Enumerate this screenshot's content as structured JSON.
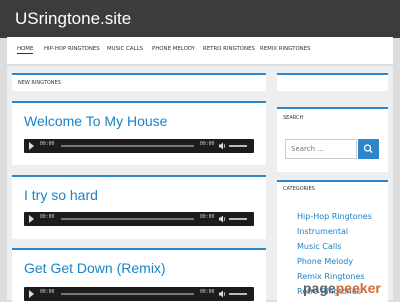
{
  "site": {
    "title": "USringtone.site"
  },
  "nav": {
    "items": [
      {
        "label": "Home"
      },
      {
        "label": "Hip-Hop Ringtones"
      },
      {
        "label": "Music Calls"
      },
      {
        "label": "Phone Melody"
      },
      {
        "label": "Retro Ringtones"
      },
      {
        "label": "Remix Ringtones"
      }
    ]
  },
  "main": {
    "section_title": "New Ringtones",
    "posts": [
      {
        "title": "Welcome To My House",
        "current_time": "00:00",
        "duration": "00:00"
      },
      {
        "title": "I try so hard",
        "current_time": "00:00",
        "duration": "00:00"
      },
      {
        "title": "Get Get Down (Remix)",
        "current_time": "00:00",
        "duration": "00:00"
      }
    ]
  },
  "sidebar": {
    "search_title": "Search",
    "search_placeholder": "Search ...",
    "categories_title": "Categories",
    "categories": [
      "Hip-Hop Ringtones",
      "Instrumental",
      "Music Calls",
      "Phone Melody",
      "Remix Ringtones",
      "Retro Ringtones"
    ]
  },
  "watermark": {
    "part1": "page",
    "part2": "peeker"
  },
  "colors": {
    "accent": "#2c86c8",
    "header": "#3c3c3c",
    "player": "#1c1c1c"
  },
  "icons": {
    "play": "play-icon",
    "volume": "volume-icon",
    "search": "search-icon"
  }
}
